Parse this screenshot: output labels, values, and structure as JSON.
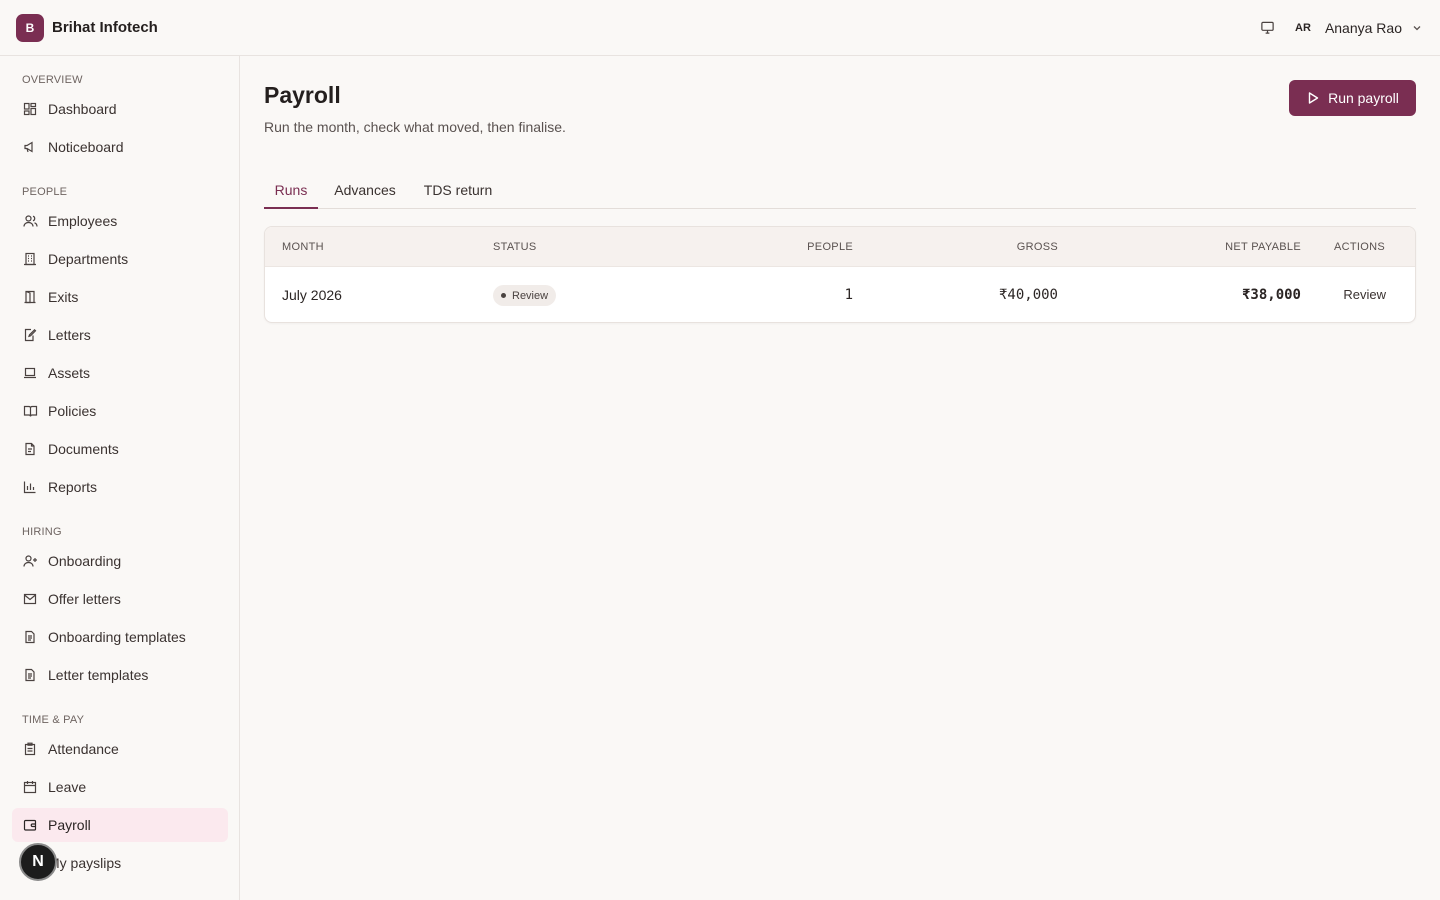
{
  "brand": {
    "logo_letter": "B",
    "name": "Brihat Infotech",
    "accent": "#7a2e52"
  },
  "user": {
    "initials": "AR",
    "name": "Ananya Rao"
  },
  "sidebar": {
    "sections": [
      {
        "label": "OVERVIEW",
        "items": [
          {
            "label": "Dashboard",
            "icon": "dashboard-icon"
          },
          {
            "label": "Noticeboard",
            "icon": "megaphone-icon"
          }
        ]
      },
      {
        "label": "PEOPLE",
        "items": [
          {
            "label": "Employees",
            "icon": "users-icon"
          },
          {
            "label": "Departments",
            "icon": "building-icon"
          },
          {
            "label": "Exits",
            "icon": "door-exit-icon"
          },
          {
            "label": "Letters",
            "icon": "edit-document-icon"
          },
          {
            "label": "Assets",
            "icon": "laptop-icon"
          },
          {
            "label": "Policies",
            "icon": "book-icon"
          },
          {
            "label": "Documents",
            "icon": "document-icon"
          },
          {
            "label": "Reports",
            "icon": "bar-chart-icon"
          }
        ]
      },
      {
        "label": "HIRING",
        "items": [
          {
            "label": "Onboarding",
            "icon": "user-plus-icon"
          },
          {
            "label": "Offer letters",
            "icon": "mail-icon"
          },
          {
            "label": "Onboarding templates",
            "icon": "file-text-icon"
          },
          {
            "label": "Letter templates",
            "icon": "file-text-icon"
          }
        ]
      },
      {
        "label": "TIME & PAY",
        "items": [
          {
            "label": "Attendance",
            "icon": "clipboard-icon"
          },
          {
            "label": "Leave",
            "icon": "calendar-icon"
          },
          {
            "label": "Payroll",
            "icon": "wallet-icon",
            "active": true
          },
          {
            "label": "My payslips",
            "icon": "receipt-icon"
          }
        ]
      }
    ]
  },
  "floating_badge": "N",
  "page": {
    "title": "Payroll",
    "subtitle": "Run the month, check what moved, then finalise.",
    "primary_action": "Run payroll",
    "tabs": [
      {
        "label": "Runs",
        "active": true
      },
      {
        "label": "Advances"
      },
      {
        "label": "TDS return"
      }
    ]
  },
  "table": {
    "columns": [
      "MONTH",
      "STATUS",
      "PEOPLE",
      "GROSS",
      "NET PAYABLE",
      "ACTIONS"
    ],
    "rows": [
      {
        "month": "July 2026",
        "status": "Review",
        "people": "1",
        "gross": "₹40,000",
        "net_payable": "₹38,000",
        "action": "Review"
      }
    ]
  }
}
